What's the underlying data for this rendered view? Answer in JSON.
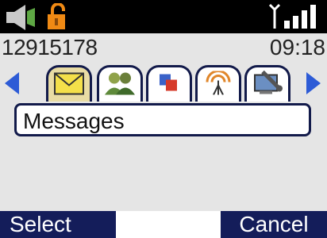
{
  "status": {
    "icons": [
      "speaker-icon",
      "unlocked-icon",
      "antenna-icon",
      "signal-bars-icon"
    ]
  },
  "info": {
    "number": "12915178",
    "time": "09:18"
  },
  "tabs": {
    "items": [
      {
        "name": "messages-icon",
        "active": true
      },
      {
        "name": "contacts-icon",
        "active": false
      },
      {
        "name": "gallery-icon",
        "active": false
      },
      {
        "name": "wireless-icon",
        "active": false
      },
      {
        "name": "settings-icon",
        "active": false
      }
    ]
  },
  "content": {
    "selected_label": "Messages"
  },
  "softkeys": {
    "left": "Select",
    "right": "Cancel"
  },
  "colors": {
    "navy": "#141d5a",
    "panel": "#e5e5e5",
    "active_tab": "#e9dca4",
    "arrow": "#2d5bd6"
  }
}
